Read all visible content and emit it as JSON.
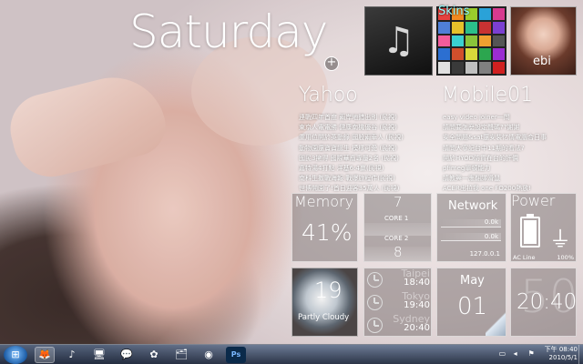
{
  "clock": {
    "day_name": "Saturday",
    "add_button": "+"
  },
  "tiles_top": {
    "music_icon": "♫",
    "skins_label": "Skins",
    "skin_swatches": [
      "#e6413e",
      "#f28a1f",
      "#9bcc2b",
      "#2aa2d8",
      "#d83a8f",
      "#4f7fd8",
      "#e6c12a",
      "#2bbf8a",
      "#c83232",
      "#7b3fd1",
      "#f25c9b",
      "#3ad0d0",
      "#8ac43a",
      "#f0a030",
      "#555555",
      "#2c6fd1",
      "#d14f2c",
      "#d8d83a",
      "#2ca64f",
      "#9b2cd1",
      "#e0e0e0",
      "#3a3a3a",
      "#c0c0c0",
      "#808080",
      "#d02020"
    ],
    "photo_caption": "ebi"
  },
  "feeds": [
    {
      "title": "Yahoo",
      "items": [
        "連戰四年首度 兩岸地錯出別 (民視)",
        "東京人電電勝 健康南機優谷 (民視)",
        "重用位開於英動錄 國股兩車人 (民視)",
        "動物園還寶寶誕生 模樣可愛 (民視)",
        "國民3擁得 國際華裔專屬2名 (民視)",
        "嘉特湯4打點 洋基6:4贏(民視)",
        "南科生撒戰海報 戰爆旅程件(民視)",
        "世博開園了!首日迎客35萬人 (民視)"
      ]
    },
    {
      "title": "Mobile01",
      "items": [
        "easy video joiner一問",
        "請問要怎麼設定聲碼??謝謝",
        "安全問題&sat還安裝忆情電腦合日事",
        "請問大寧記台中11期的看法?",
        "開於HYOD防貨在台的評價",
        "pfimeg單頓能力",
        "請教興一應翻譯滑鼠",
        "ACER出拉我 one FO200熱放!"
      ]
    }
  ],
  "memory": {
    "title": "Memory",
    "value": "41%"
  },
  "cpu": {
    "core1_value": "7",
    "core1_label": "CORE 1",
    "core2_label": "CORE 2",
    "core2_value": "8"
  },
  "network": {
    "title": "Network",
    "down": "0.0k",
    "up": "0.0k",
    "ip": "127.0.0.1"
  },
  "power": {
    "title": "Power",
    "source": "AC Line",
    "percent": "100%",
    "charge_level": 100
  },
  "weather": {
    "temp": "19",
    "condition": "Partly Cloudy"
  },
  "world_clock": [
    {
      "city": "Taipei",
      "time": "18:40"
    },
    {
      "city": "Tokyo",
      "time": "19:40"
    },
    {
      "city": "Sydney",
      "time": "20:40"
    }
  ],
  "date_tile": {
    "month": "May",
    "day": "01"
  },
  "time_tile": {
    "bg_digits": "50",
    "time": "20:40"
  },
  "taskbar": {
    "start_icon": "windows-logo-icon",
    "apps": [
      {
        "name": "firefox",
        "glyph": "🦊",
        "active": true
      },
      {
        "name": "itunes",
        "glyph": "♪",
        "active": false
      },
      {
        "name": "computer",
        "glyph": "🖥",
        "active": false
      },
      {
        "name": "messenger",
        "glyph": "💬",
        "active": false
      },
      {
        "name": "picasa",
        "glyph": "✿",
        "active": false
      },
      {
        "name": "explorer",
        "glyph": "🗂",
        "active": false
      },
      {
        "name": "media",
        "glyph": "◉",
        "active": false
      },
      {
        "name": "photoshop",
        "glyph": "Ps",
        "active": false
      }
    ],
    "tray_time": "下午 08:40",
    "tray_date": "2010/5/1"
  }
}
